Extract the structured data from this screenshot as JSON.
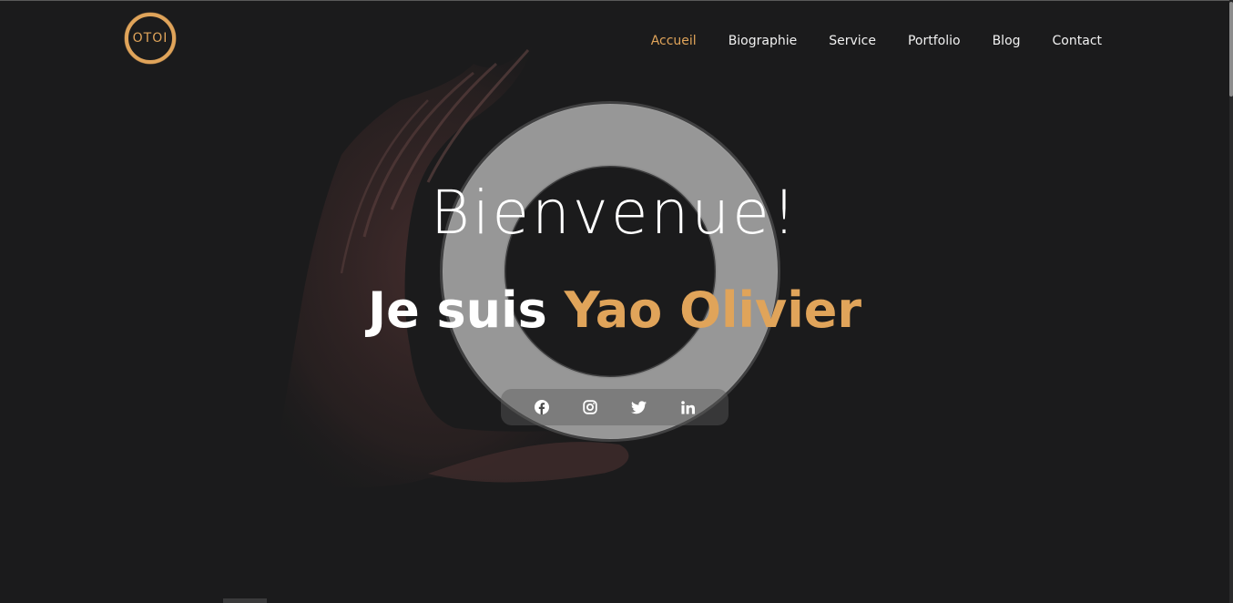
{
  "brand": {
    "logo_text": "OTOI",
    "accent_color": "#e0a45a"
  },
  "nav": {
    "items": [
      {
        "label": "Accueil",
        "active": true
      },
      {
        "label": "Biographie",
        "active": false
      },
      {
        "label": "Service",
        "active": false
      },
      {
        "label": "Portfolio",
        "active": false
      },
      {
        "label": "Blog",
        "active": false
      },
      {
        "label": "Contact",
        "active": false
      }
    ]
  },
  "hero": {
    "headline": "Bienvenue!",
    "intro": "Je suis",
    "name": "Yao Olivier"
  },
  "social": {
    "icons": [
      "facebook-icon",
      "instagram-icon",
      "twitter-icon",
      "linkedin-icon"
    ]
  },
  "colors": {
    "background": "#1b1b1c",
    "text": "#ffffff",
    "accent": "#e0a45a"
  }
}
